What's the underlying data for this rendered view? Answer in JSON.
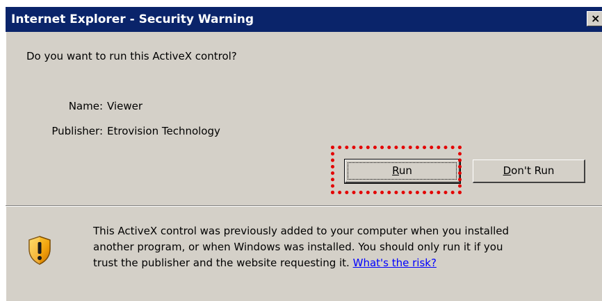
{
  "window": {
    "title": "Internet Explorer - Security Warning",
    "close_glyph": "×"
  },
  "prompt": {
    "question": "Do you want to run this ActiveX control?"
  },
  "details": {
    "name_label": "Name:",
    "name_value": "Viewer",
    "publisher_label": "Publisher:",
    "publisher_value": "Etrovision Technology"
  },
  "buttons": {
    "run_accel": "R",
    "run_rest": "un",
    "dontrun_accel": "D",
    "dontrun_rest": "on't Run"
  },
  "info": {
    "line1": "This ActiveX control was previously added to your computer when you installed",
    "line2": "another program, or when Windows was installed. You should only run it if you",
    "line3": "trust the publisher and the website requesting it.",
    "risk_link": "What's the risk?"
  },
  "icons": {
    "shield": "warning-shield-icon",
    "close": "close-icon"
  },
  "colors": {
    "titlebar": "#0a246a",
    "dialog_face": "#d4d0c8",
    "highlight": "#e30000",
    "link": "#0000ff"
  }
}
